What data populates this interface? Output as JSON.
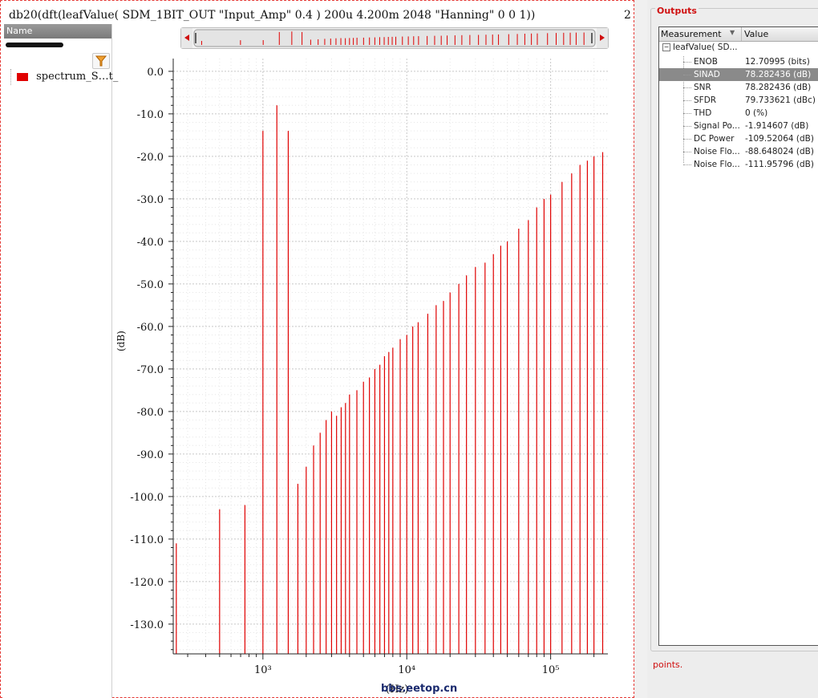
{
  "plot": {
    "title": "db20(dft(leafValue( SDM_1BIT_OUT \"Input_Amp\" 0.4 )  200u 4.200m 2048 \"Hanning\" 0 0 1))",
    "title_suffix": "2",
    "y_axis_label": "(dB)",
    "x_axis_label": "(Hz)",
    "watermark": "bbs.eetop.cn"
  },
  "legend": {
    "header": "Name",
    "filter_icon": "filter-icon",
    "entries": [
      {
        "label": "spectrum_S…t_",
        "color": "#e00000"
      }
    ]
  },
  "outputs": {
    "title": "Outputs",
    "columns": {
      "measurement": "Measurement",
      "value": "Value"
    },
    "parent": "leafValue( SD...",
    "rows": [
      {
        "measurement": "ENOB",
        "value": "12.70995 (bits)"
      },
      {
        "measurement": "SINAD",
        "value": "78.282436 (dB)",
        "selected": true
      },
      {
        "measurement": "SNR",
        "value": "78.282436 (dB)"
      },
      {
        "measurement": "SFDR",
        "value": "79.733621 (dBc)"
      },
      {
        "measurement": "THD",
        "value": "0 (%)"
      },
      {
        "measurement": "Signal Po...",
        "value": "-1.914607 (dB)"
      },
      {
        "measurement": "DC Power",
        "value": "-109.52064 (dB)"
      },
      {
        "measurement": "Noise Flo...",
        "value": "-88.648024 (dB)"
      },
      {
        "measurement": "Noise Flo...",
        "value": "-111.95796 (dB)"
      }
    ],
    "status": "points."
  },
  "chart_data": {
    "type": "bar",
    "xscale": "log",
    "xlim": [
      238,
      250000
    ],
    "ylim": [
      -137,
      3
    ],
    "ylabel": "(dB)",
    "xlabel": "(Hz)",
    "yticks": [
      0,
      -10,
      -20,
      -30,
      -40,
      -50,
      -60,
      -70,
      -80,
      -90,
      -100,
      -110,
      -120,
      -130
    ],
    "ytick_labels": [
      "0.0",
      "-10.0",
      "-20.0",
      "-30.0",
      "-40.0",
      "-50.0",
      "-60.0",
      "-70.0",
      "-80.0",
      "-90.0",
      "-100.0",
      "-110.0",
      "-120.0",
      "-130.0"
    ],
    "xticks": [
      1000,
      10000,
      100000
    ],
    "xtick_labels": [
      "10³",
      "10⁴",
      "10⁵"
    ],
    "grid": true,
    "color": "#e00000",
    "series": [
      {
        "x": [
          250,
          500,
          750,
          1000,
          1250,
          1500,
          1750,
          2000,
          2250,
          2500,
          2750,
          3000,
          3250,
          3500,
          3750,
          4000,
          4500,
          5000,
          5500,
          6000,
          6500,
          7000,
          7500,
          8000,
          9000,
          10000,
          11000,
          12000,
          14000,
          16000,
          18000,
          20000,
          23000,
          26000,
          30000,
          35000,
          40000,
          45000,
          50000,
          60000,
          70000,
          80000,
          90000,
          100000,
          120000,
          140000,
          160000,
          180000,
          200000,
          230000
        ],
        "values": [
          -111,
          -103,
          -102,
          -14,
          -8,
          -14,
          -97,
          -93,
          -88,
          -85,
          -82,
          -80,
          -81,
          -79,
          -78,
          -76,
          -75,
          -73,
          -72,
          -70,
          -69,
          -67,
          -66,
          -65,
          -63,
          -62,
          -60,
          -59,
          -57,
          -55,
          -54,
          -52,
          -50,
          -48,
          -46,
          -45,
          -43,
          -41,
          -40,
          -37,
          -35,
          -32,
          -30,
          -29,
          -26,
          -24,
          -22,
          -21,
          -20,
          -19
        ]
      }
    ]
  }
}
